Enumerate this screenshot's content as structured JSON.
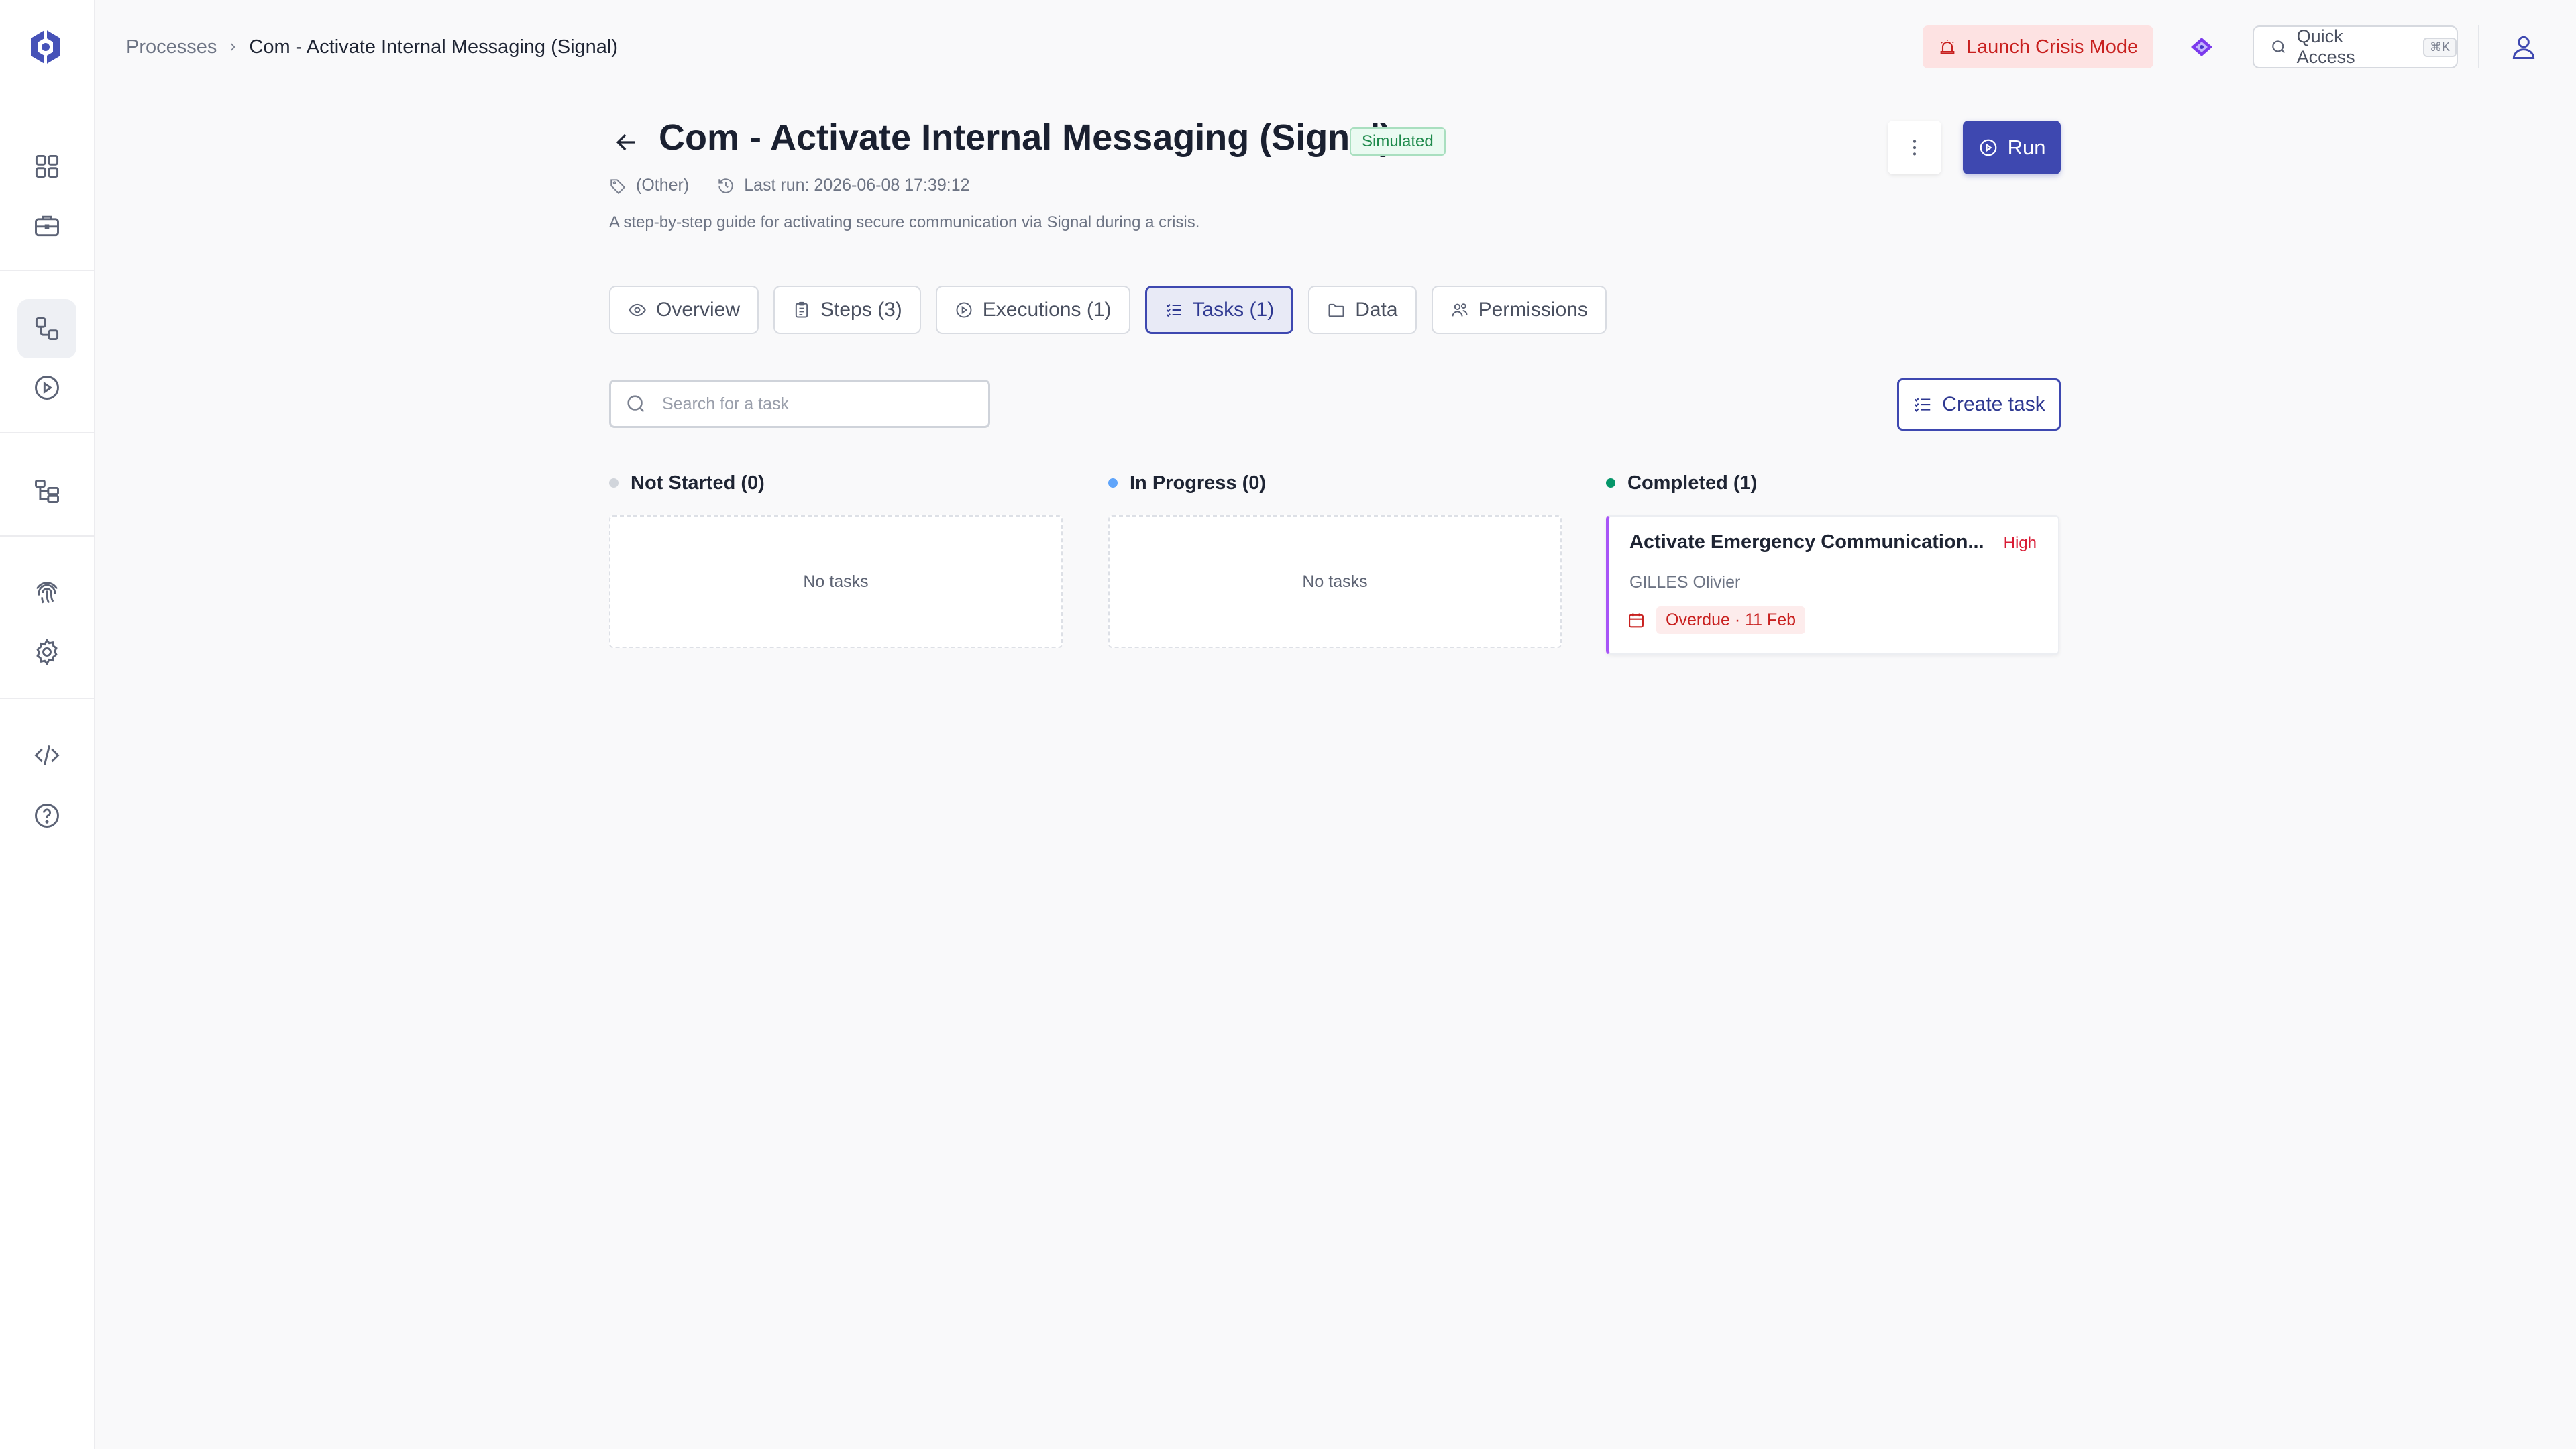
{
  "breadcrumb": {
    "parent": "Processes",
    "current": "Com - Activate Internal Messaging (Signal)"
  },
  "topbar": {
    "crisis_label": "Launch Crisis Mode",
    "quick_access_label": "Quick Access",
    "quick_access_shortcut": "⌘K"
  },
  "header": {
    "title": "Com - Activate Internal Messaging (Signal)",
    "badge": "Simulated",
    "category": "(Other)",
    "last_run": "Last run: 2026-06-08 17:39:12",
    "description": "A step-by-step guide for activating secure communication via Signal during a crisis.",
    "run_label": "Run"
  },
  "tabs": [
    {
      "label": "Overview",
      "icon": "eye-icon"
    },
    {
      "label": "Steps (3)",
      "icon": "clipboard-icon"
    },
    {
      "label": "Executions (1)",
      "icon": "play-circle-icon"
    },
    {
      "label": "Tasks (1)",
      "icon": "list-checks-icon",
      "active": true
    },
    {
      "label": "Data",
      "icon": "folder-icon"
    },
    {
      "label": "Permissions",
      "icon": "users-icon"
    }
  ],
  "toolbar": {
    "search_placeholder": "Search for a task",
    "create_label": "Create task"
  },
  "board": {
    "columns": [
      {
        "title": "Not Started (0)",
        "empty_text": "No tasks",
        "dot_color": "#d1d5db"
      },
      {
        "title": "In Progress (0)",
        "empty_text": "No tasks",
        "dot_color": "#60a5fa"
      },
      {
        "title": "Completed (1)",
        "dot_color": "#059669"
      }
    ],
    "task": {
      "title": "Activate Emergency Communication...",
      "priority": "High",
      "assignee": "GILLES Olivier",
      "due": "Overdue · 11 Feb"
    }
  },
  "colors": {
    "accent": "#3e48b0",
    "danger": "#c8201f",
    "success": "#1f8a4c",
    "task_border": "#a855f7"
  }
}
